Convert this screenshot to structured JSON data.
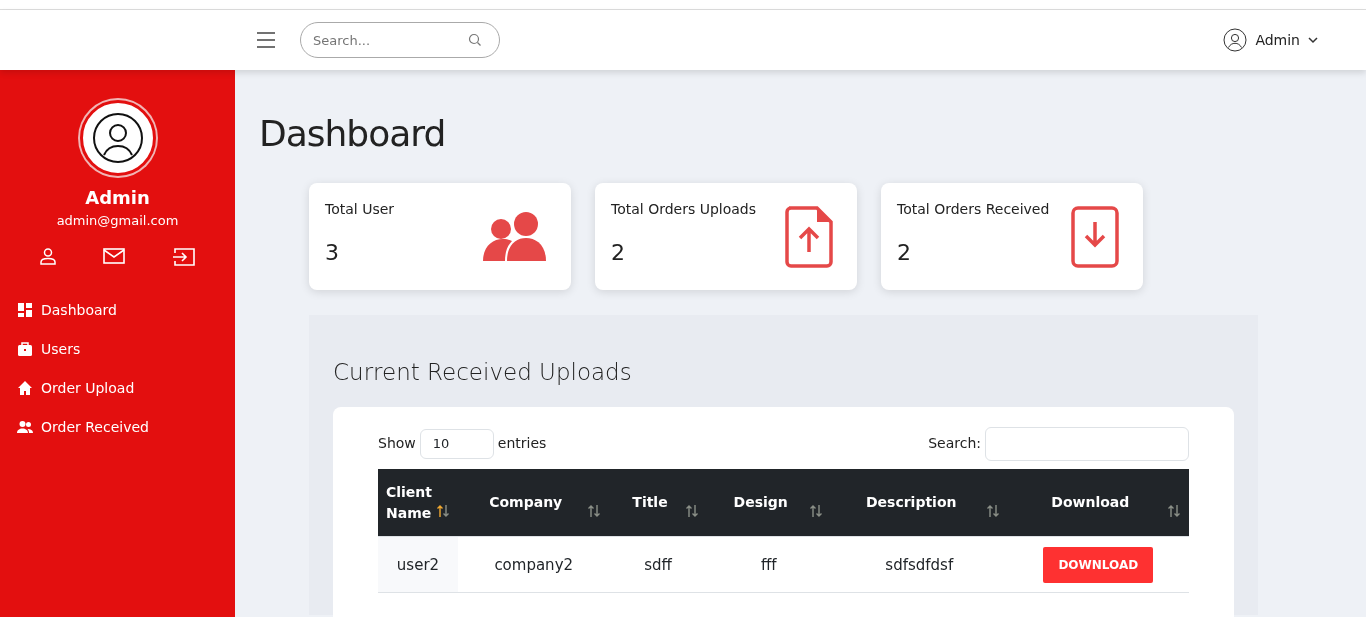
{
  "header": {
    "search": {
      "placeholder": "Search..."
    },
    "user": "Admin"
  },
  "sidebar": {
    "name": "Admin",
    "email": "admin@gmail.com",
    "items": [
      {
        "label": "Dashboard",
        "kind": "grid"
      },
      {
        "label": "Users",
        "kind": "briefcase"
      },
      {
        "label": "Order Upload",
        "kind": "home"
      },
      {
        "label": "Order Received",
        "kind": "people"
      }
    ]
  },
  "page_title": "Dashboard",
  "stats": [
    {
      "label": "Total User",
      "value": "3",
      "kind": "users"
    },
    {
      "label": "Total Orders Uploads",
      "value": "2",
      "kind": "upload"
    },
    {
      "label": "Total Orders Received",
      "value": "2",
      "kind": "download"
    }
  ],
  "uploads": {
    "title": "Current Received Uploads",
    "show_label": "Show",
    "entries_value": "10",
    "entries_label": "entries",
    "search_label": "Search:",
    "columns": [
      {
        "label": "Client Name",
        "sorted": true
      },
      {
        "label": "Company",
        "sorted": false
      },
      {
        "label": "Title",
        "sorted": false
      },
      {
        "label": "Design",
        "sorted": false
      },
      {
        "label": "Description",
        "sorted": false
      },
      {
        "label": "Download",
        "sorted": false
      }
    ],
    "rows": [
      {
        "cells": [
          "user2",
          "company2",
          "sdff",
          "fff",
          "sdfsdfdsf"
        ],
        "button": "DOWNLOAD"
      }
    ]
  }
}
